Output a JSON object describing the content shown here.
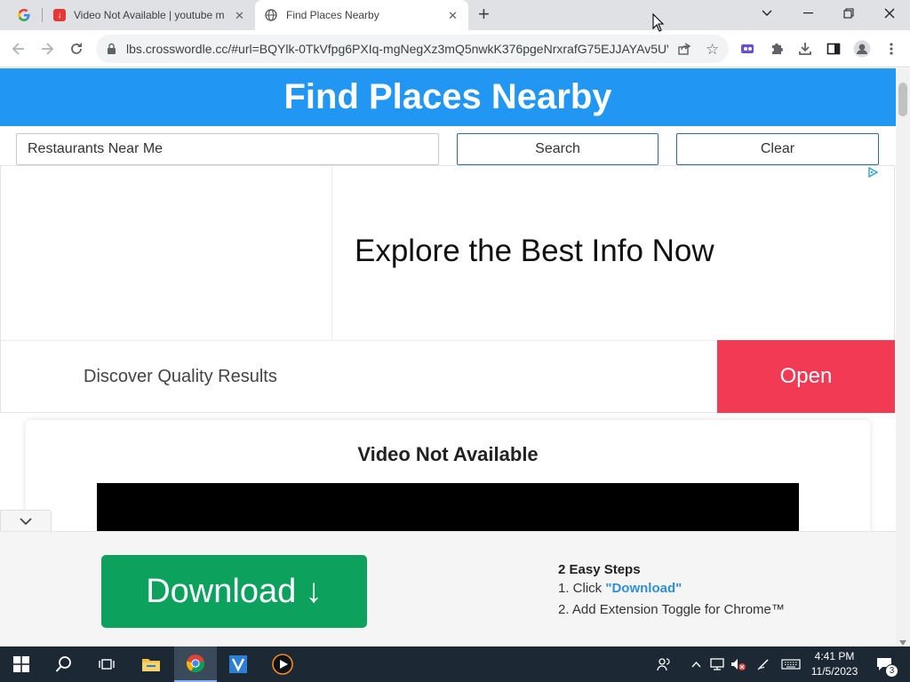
{
  "browser": {
    "tabs": [
      {
        "title": "Video Not Available | youtube m",
        "icon": "download-red-icon",
        "active": false
      },
      {
        "title": "Find Places Nearby",
        "icon": "globe-icon",
        "active": true
      }
    ],
    "url": "lbs.crosswordle.cc/#url=BQYlk-0TkVfpg6PXIq-mgNegXz3mQ5nwkK376pgeNrxrafG75EJJAYAv5UV...",
    "new_tab_symbol": "+",
    "close_symbol": "✕"
  },
  "page": {
    "header_title": "Find Places Nearby",
    "search_value": "Restaurants Near Me",
    "search_button": "Search",
    "clear_button": "Clear",
    "ad": {
      "headline": "Explore the Best Info Now",
      "subline": "Discover Quality Results",
      "open_button": "Open",
      "open_color": "#f23a55"
    },
    "video_title": "Video Not Available",
    "header_color": "#2196f3"
  },
  "banner": {
    "download_button": "Download ↓",
    "download_color": "#0ca25e",
    "steps_title": "2 Easy Steps",
    "step1_prefix": "1. Click ",
    "step1_highlight": "\"Download\"",
    "step2": "2. Add Extension Toggle for Chrome™"
  },
  "taskbar": {
    "time": "4:41 PM",
    "date": "11/5/2023",
    "notification_count": "3"
  }
}
